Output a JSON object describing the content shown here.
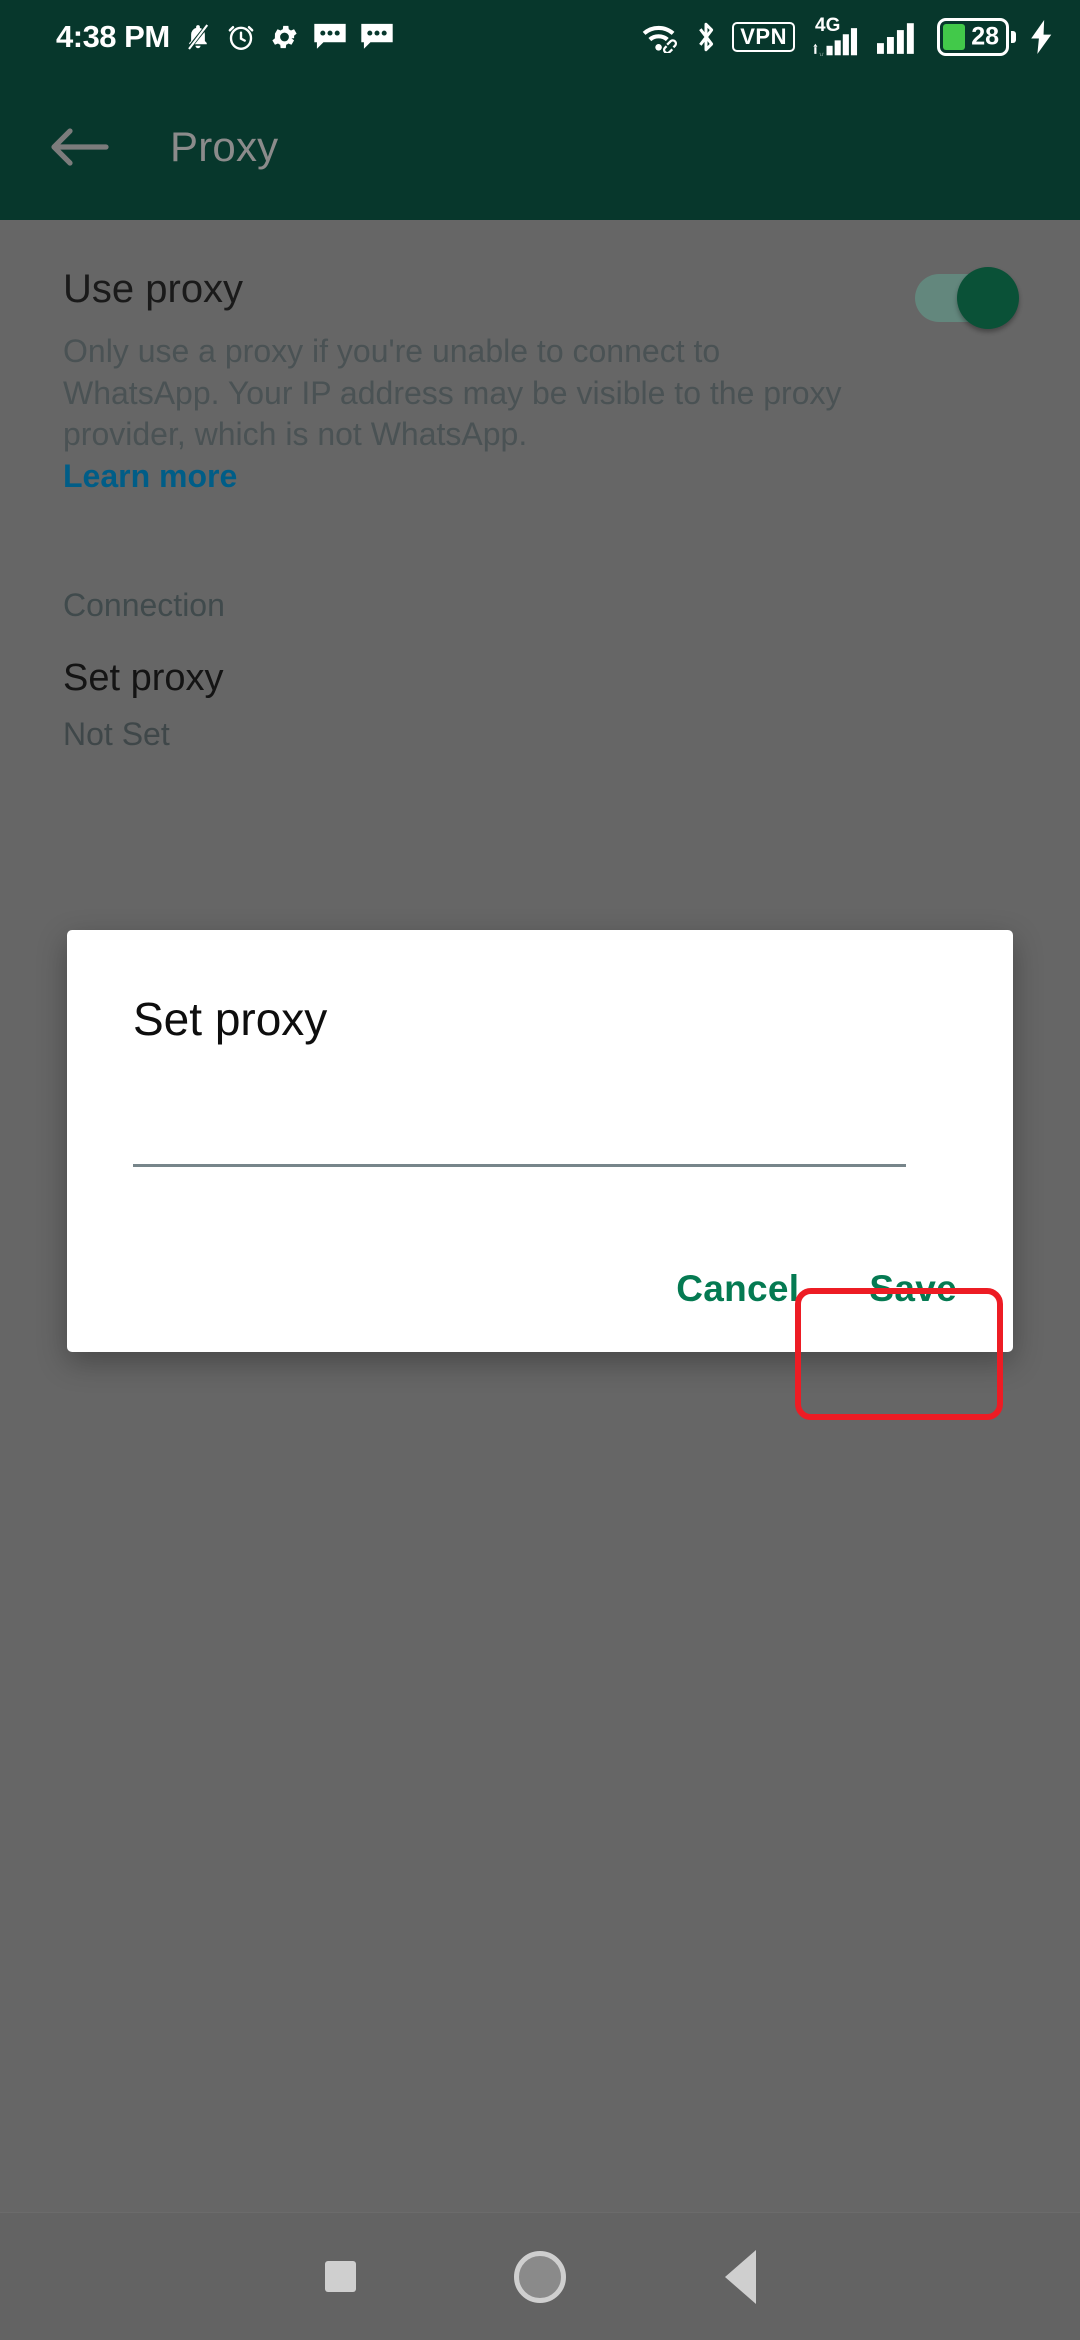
{
  "status_bar": {
    "time": "4:38 PM",
    "battery_level": "28",
    "network_label": "4G",
    "vpn_label": "VPN",
    "icons": [
      "mute-bell-icon",
      "alarm-clock-icon",
      "gear-icon",
      "chat-bubble-icon",
      "chat-bubble-icon",
      "wifi-link-icon",
      "bluetooth-icon",
      "vpn-icon",
      "cellular-signal-icon",
      "cellular-signal-icon",
      "battery-icon",
      "charging-bolt-icon"
    ],
    "background_color": "#07372C"
  },
  "app_bar": {
    "title": "Proxy",
    "back_icon": "back-arrow-icon",
    "background_color": "#07372C",
    "title_color": "#8B8B8B"
  },
  "content": {
    "use_proxy": {
      "title": "Use proxy",
      "description": "Only use a proxy if you're unable to connect to WhatsApp. Your IP address may be visible to the proxy provider, which is not WhatsApp.",
      "learn_more": "Learn more",
      "learn_more_color": "#005D87",
      "toggle_state": "on",
      "toggle_on_color": "#0A5137"
    },
    "connection_section_label": "Connection",
    "set_proxy": {
      "title": "Set proxy",
      "value": "Not Set"
    }
  },
  "dialog": {
    "title": "Set proxy",
    "input_value": "",
    "input_placeholder": "",
    "cancel_label": "Cancel",
    "save_label": "Save",
    "button_color": "#057A52",
    "highlight_color": "#ED1C24",
    "highlighted_button": "Save"
  },
  "nav_bar": {
    "recents_label": "Recents",
    "home_label": "Home",
    "back_label": "Back"
  }
}
